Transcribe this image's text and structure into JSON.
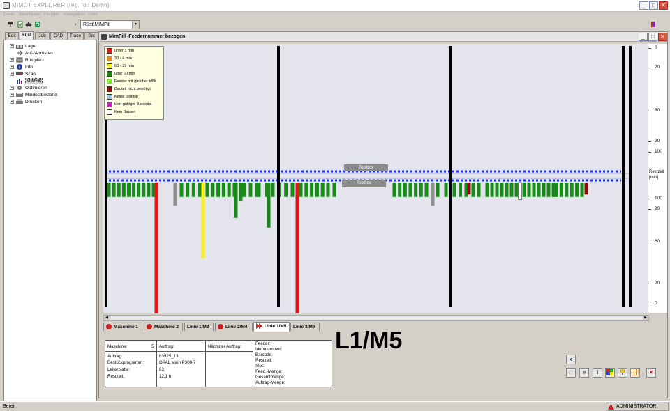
{
  "app": {
    "title": "MIMOT EXPLORER (reg. for. Demo)",
    "menu": [
      "Datei",
      "Bearbeiten",
      "Fenster",
      "Navigation",
      "Hilfe"
    ],
    "path_value": "Rüst\\MIMFill"
  },
  "left_tabs": [
    "Edit",
    "Rüst",
    "Job",
    "CAD",
    "Trace",
    "Set"
  ],
  "tree": [
    {
      "label": "Lager",
      "expand": true,
      "icon": "warehouse-icon"
    },
    {
      "label": "Auf-/Abrüsten",
      "expand": false,
      "icon": "arrows-icon"
    },
    {
      "label": "Rüstplatz",
      "expand": true,
      "icon": "rack-icon"
    },
    {
      "label": "Info",
      "expand": true,
      "icon": "info-icon"
    },
    {
      "label": "Scan",
      "expand": true,
      "icon": "scan-icon"
    },
    {
      "label": "MIMFill",
      "expand": false,
      "icon": "chart-icon",
      "selected": true
    },
    {
      "label": "Optimieren",
      "expand": true,
      "icon": "gear-icon"
    },
    {
      "label": "Mindestbestand",
      "expand": true,
      "icon": "stock-icon"
    },
    {
      "label": "Drucken",
      "expand": true,
      "icon": "printer-icon"
    }
  ],
  "window": {
    "title": "MimFill  -Feedernummer bezogen"
  },
  "legend": [
    {
      "label": "unter  3     min",
      "color": "#e01818"
    },
    {
      "label": "30    -  4     min",
      "color": "#f08818"
    },
    {
      "label": "60    -  29   min",
      "color": "#f8f020"
    },
    {
      "label": "über  60    min",
      "color": "#1a8a1a"
    },
    {
      "label": "Feeder mit gleicher IdNr",
      "color": "#80f030"
    },
    {
      "label": "Bauteil nicht benötigt",
      "color": "#8a0c0c"
    },
    {
      "label": "Keine IdentNr",
      "color": "#a0c8e8"
    },
    {
      "label": "kein gültiger Barcode.",
      "color": "#c820c0"
    },
    {
      "label": "Kein Bauteil",
      "color": "#ffffff"
    }
  ],
  "toolbox_label": "Toolbox",
  "axis": {
    "title": "Restzeit [min]",
    "top_ticks": [
      "0",
      "20",
      "60",
      "90",
      "100"
    ],
    "bottom_ticks": [
      "100",
      "90",
      "60",
      "20",
      "0"
    ]
  },
  "chart_data": {
    "type": "bar",
    "ylabel": "Restzeit [min]",
    "ylim": [
      0,
      100
    ],
    "top_bars": [],
    "bottom_bars": [
      {
        "start": 156,
        "end": 220,
        "count": 10,
        "value": 5,
        "color": "#1a8a1a"
      },
      {
        "x": 224,
        "value": 100,
        "color": "#e01818"
      },
      {
        "x": 251,
        "value": 12,
        "color": "#909090"
      },
      {
        "start": 260,
        "end": 286,
        "count": 4,
        "value": 5,
        "color": "#1a8a1a"
      },
      {
        "x": 291,
        "value": 55,
        "color": "#f8f020"
      },
      {
        "start": 297,
        "end": 336,
        "count": 6,
        "value": 5,
        "color": "#1a8a1a"
      },
      {
        "x": 338,
        "value": 22,
        "color": "#1a8a1a"
      },
      {
        "x": 345,
        "value": 8,
        "color": "#1a8a1a"
      },
      {
        "start": 350,
        "end": 368,
        "count": 3,
        "value": 5,
        "color": "#1a8a1a"
      },
      {
        "start": 371,
        "end": 382,
        "count": 2,
        "value": 5,
        "color": "#1a8a1a"
      },
      {
        "x": 385,
        "value": 30,
        "color": "#1a8a1a"
      },
      {
        "start": 391,
        "end": 419,
        "count": 4,
        "value": 5,
        "color": "#1a8a1a"
      },
      {
        "x": 426,
        "value": 100,
        "color": "#e01818"
      },
      {
        "start": 431,
        "end": 470,
        "count": 6,
        "value": 5,
        "color": "#1a8a1a"
      },
      {
        "x": 479,
        "value": 5,
        "color": "#1a8a1a"
      },
      {
        "start": 565,
        "end": 611,
        "count": 7,
        "value": 5,
        "color": "#1a8a1a"
      },
      {
        "x": 620,
        "value": 12,
        "color": "#909090"
      },
      {
        "start": 627,
        "end": 639,
        "count": 2,
        "value": 5,
        "color": "#1a8a1a"
      },
      {
        "start": 651,
        "end": 668,
        "count": 3,
        "value": 5,
        "color": "#1a8a1a"
      },
      {
        "x": 672,
        "value": 3,
        "color": "#8a0c0c"
      },
      {
        "start": 678,
        "end": 686,
        "count": 2,
        "value": 5,
        "color": "#1a8a1a"
      },
      {
        "start": 698,
        "end": 740,
        "count": 7,
        "value": 5,
        "color": "#1a8a1a"
      },
      {
        "x": 745,
        "value": 7,
        "color": "#ffffff"
      },
      {
        "start": 751,
        "end": 793,
        "count": 7,
        "value": 5,
        "color": "#1a8a1a"
      },
      {
        "start": 797,
        "end": 834,
        "count": 6,
        "value": 5,
        "color": "#1a8a1a"
      },
      {
        "x": 840,
        "value": 3,
        "color": "#8a0c0c"
      }
    ],
    "machine_separators": [
      152,
      399,
      646,
      893,
      903
    ]
  },
  "machine_tabs": [
    {
      "label": "Maschine 1",
      "icon": "red-dot"
    },
    {
      "label": "Maschine 2",
      "icon": "red-dot"
    },
    {
      "label": "Linie 1/M3",
      "icon": "none"
    },
    {
      "label": "Linie 2/M4",
      "icon": "red-dot"
    },
    {
      "label": "Linie 1/M5",
      "icon": "red-arrow",
      "active": true
    },
    {
      "label": "Linie 3/M6",
      "icon": "none"
    }
  ],
  "info": {
    "maschine_label": "Maschine:",
    "maschine_value": "5",
    "auftrag_head": "Auftrag:",
    "naechster_head": "Nächster Auftrag:",
    "auftrag_label": "Auftrag:",
    "auftrag_value": "83525_13",
    "programm_label": "Bestückprogramm:",
    "programm_value": "OPAL Main P300-7",
    "platte_label": "Leiterplatte:",
    "platte_value": "63",
    "restzeit_label": "Restzeit:",
    "restzeit_value": "12,1 h"
  },
  "feeder_info": [
    "Feeder:",
    "Identnummer:",
    "Barcode:",
    "Restzeit:",
    "Slot:",
    "Feed.-Menge:",
    "Gesamtmenge:",
    "Auftrag-Menge:"
  ],
  "big_label": "L1/M5",
  "status": {
    "left": "Bereit",
    "user": "ADMINISTRATOR"
  }
}
